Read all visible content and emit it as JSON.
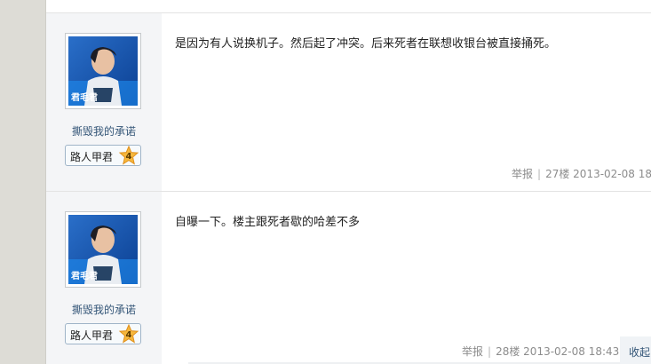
{
  "posts": [
    {
      "username": "撕毁我的承诺",
      "rank_label": "路人甲君",
      "rank_level": "4",
      "avatar_caption": "君毛君",
      "content": "是因为有人说换机子。然后起了冲突。后来死者在联想收银台被直接捅死。",
      "report_label": "举报",
      "floor": "27楼",
      "timestamp": "2013-02-08 18:"
    },
    {
      "username": "撕毁我的承诺",
      "rank_label": "路人甲君",
      "rank_level": "4",
      "avatar_caption": "君毛君",
      "content": "自曝一下。楼主跟死者歇的哈差不多",
      "report_label": "举报",
      "floor": "28楼",
      "timestamp": "2013-02-08 18:43",
      "collapse_label": "收起"
    }
  ],
  "meta_separator": "|",
  "colors": {
    "username": "#335577",
    "meta": "#8c8c8c",
    "star": "#f6b73c"
  },
  "icons": [
    "user-avatar-image",
    "level-star-icon"
  ]
}
